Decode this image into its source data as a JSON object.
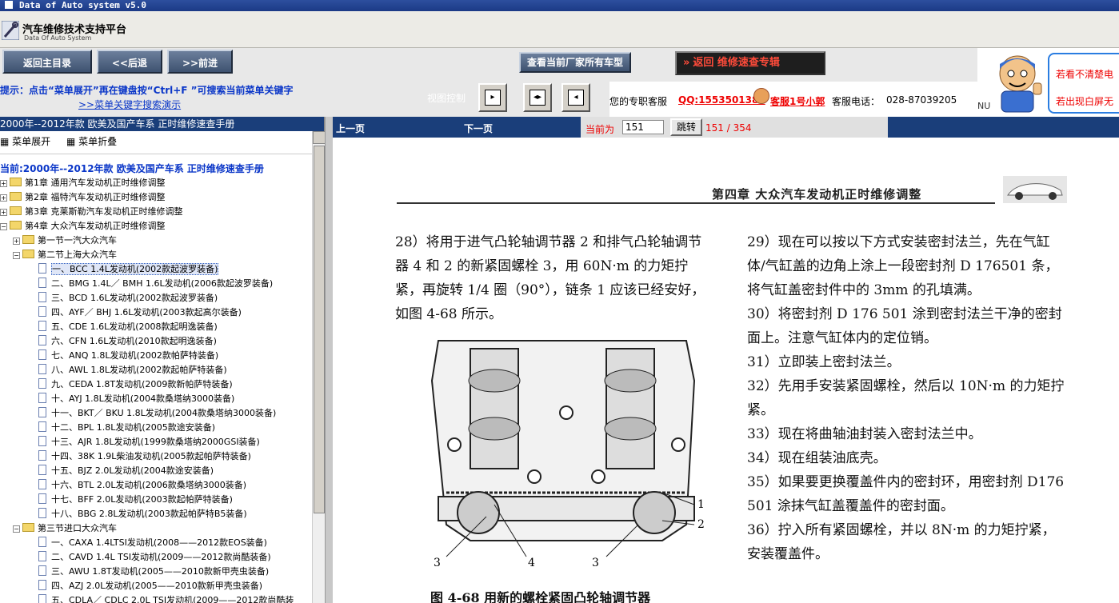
{
  "window": {
    "title": "Data of Auto system v5.0"
  },
  "header": {
    "app_title": "汽车维修技术支持平台",
    "app_subtitle": "Data Of Auto System"
  },
  "toolbar": {
    "home_label": "返回主目录",
    "back_label": "<<后退",
    "forward_label": ">>前进",
    "models_label": "查看当前厂家所有车型",
    "quick_arrows": "»",
    "quick_label": "返回  维修速查专辑"
  },
  "banner": {
    "line1": "若看不清楚电",
    "line2": "若出现白屏无",
    "footer": "NU"
  },
  "hint": {
    "text": "提示：点击“菜单展开”再在键盘按“Ctrl+F ”可搜索当前菜单关键字",
    "link": ">>菜单关键字搜索演示",
    "view_control": "视图控制"
  },
  "service": {
    "label": "您的专职客服",
    "qq": "QQ:1553501388",
    "agent": "客服1号小郭",
    "phone_label": "客服电话：",
    "phone": "028-87039205"
  },
  "tree": {
    "header": "2000年--2012年款 欧美及国产车系 正时维修速查手册",
    "expand_label": "菜单展开",
    "collapse_label": "菜单折叠",
    "current": "当前:2000年--2012年款 欧美及国产车系 正时维修速查手册",
    "chapters": [
      "第1章 通用汽车发动机正时维修调整",
      "第2章 福特汽车发动机正时维修调整",
      "第3章 克莱斯勒汽车发动机正时维修调整",
      "第4章 大众汽车发动机正时维修调整"
    ],
    "sections": [
      "第一节一汽大众汽车",
      "第二节上海大众汽车",
      "第三节进口大众汽车"
    ],
    "section2_items": [
      "一、BCC 1.4L发动机(2002款起波罗装备)",
      "二、BMG 1.4L／ BMH 1.6L发动机(2006款起波罗装备)",
      "三、BCD 1.6L发动机(2002款起波罗装备)",
      "四、AYF／ BHJ 1.6L发动机(2003款起高尔装备)",
      "五、CDE 1.6L发动机(2008款起明逸装备)",
      "六、CFN 1.6L发动机(2010款起明逸装备)",
      "七、ANQ 1.8L发动机(2002款帕萨特装备)",
      "八、AWL 1.8L发动机(2002款起帕萨特装备)",
      "九、CEDA 1.8T发动机(2009款新帕萨特装备)",
      "十、AYJ 1.8L发动机(2004款桑塔纳3000装备)",
      "十一、BKT／ BKU 1.8L发动机(2004款桑塔纳3000装备)",
      "十二、BPL 1.8L发动机(2005款途安装备)",
      "十三、AJR 1.8L发动机(1999款桑塔纳2000GSI装备)",
      "十四、38K 1.9L柴油发动机(2005款起帕萨特装备)",
      "十五、BJZ 2.0L发动机(2004款途安装备)",
      "十六、BTL 2.0L发动机(2006款桑塔纳3000装备)",
      "十七、BFF 2.0L发动机(2003款起帕萨特装备)",
      "十八、BBG 2.8L发动机(2003款起帕萨特B5装备)"
    ],
    "section3_items": [
      "一、CAXA 1.4LTSI发动机(2008——2012款EOS装备)",
      "二、CAVD 1.4L TSI发动机(2009——2012款尚酷装备)",
      "三、AWU 1.8T发动机(2005——2010款新甲壳虫装备)",
      "四、AZJ 2.0L发动机(2005——2010款新甲壳虫装备)",
      "五、CDLA／ CDLC 2.0L TSI发动机(2009——2012款尚酷装"
    ]
  },
  "nav": {
    "prev": "上一页",
    "next": "下一页",
    "page_label": "当前为",
    "page_value": "151",
    "jump_label": "跳转",
    "page_count": "151 / 354"
  },
  "doc": {
    "chapter_header": "第四章  大众汽车发动机正时维修调整",
    "col1": "28）将用于进气凸轮轴调节器 2 和排气凸轮轴调节器 4 和 2 的新紧固螺栓 3，用 60N·m 的力矩拧紧，再旋转 1/4 圈（90°），链条 1 应该已经安好，如图 4-68 所示。",
    "col2_paras": [
      "29）现在可以按以下方式安装密封法兰，先在气缸体/气缸盖的边角上涂上一段密封剂 D 176501 条，将气缸盖密封件中的 3mm 的孔填满。",
      "30）将密封剂 D 176 501 涂到密封法兰干净的密封面上。注意气缸体内的定位销。",
      "31）立即装上密封法兰。",
      "32）先用手安装紧固螺栓，然后以 10N·m 的力矩拧紧。",
      "33）现在将曲轴油封装入密封法兰中。",
      "34）现在组装油底壳。",
      "35）如果要更换覆盖件内的密封环，用密封剂 D176 501 涂抹气缸盖覆盖件的密封面。",
      "36）拧入所有紧固螺栓，并以 8N·m 的力矩拧紧，安装覆盖件。"
    ],
    "figure_labels": [
      "1",
      "2",
      "3",
      "4",
      "3"
    ],
    "figure_caption": "图 4-68   用新的螺栓紧固凸轮轴调节器"
  }
}
